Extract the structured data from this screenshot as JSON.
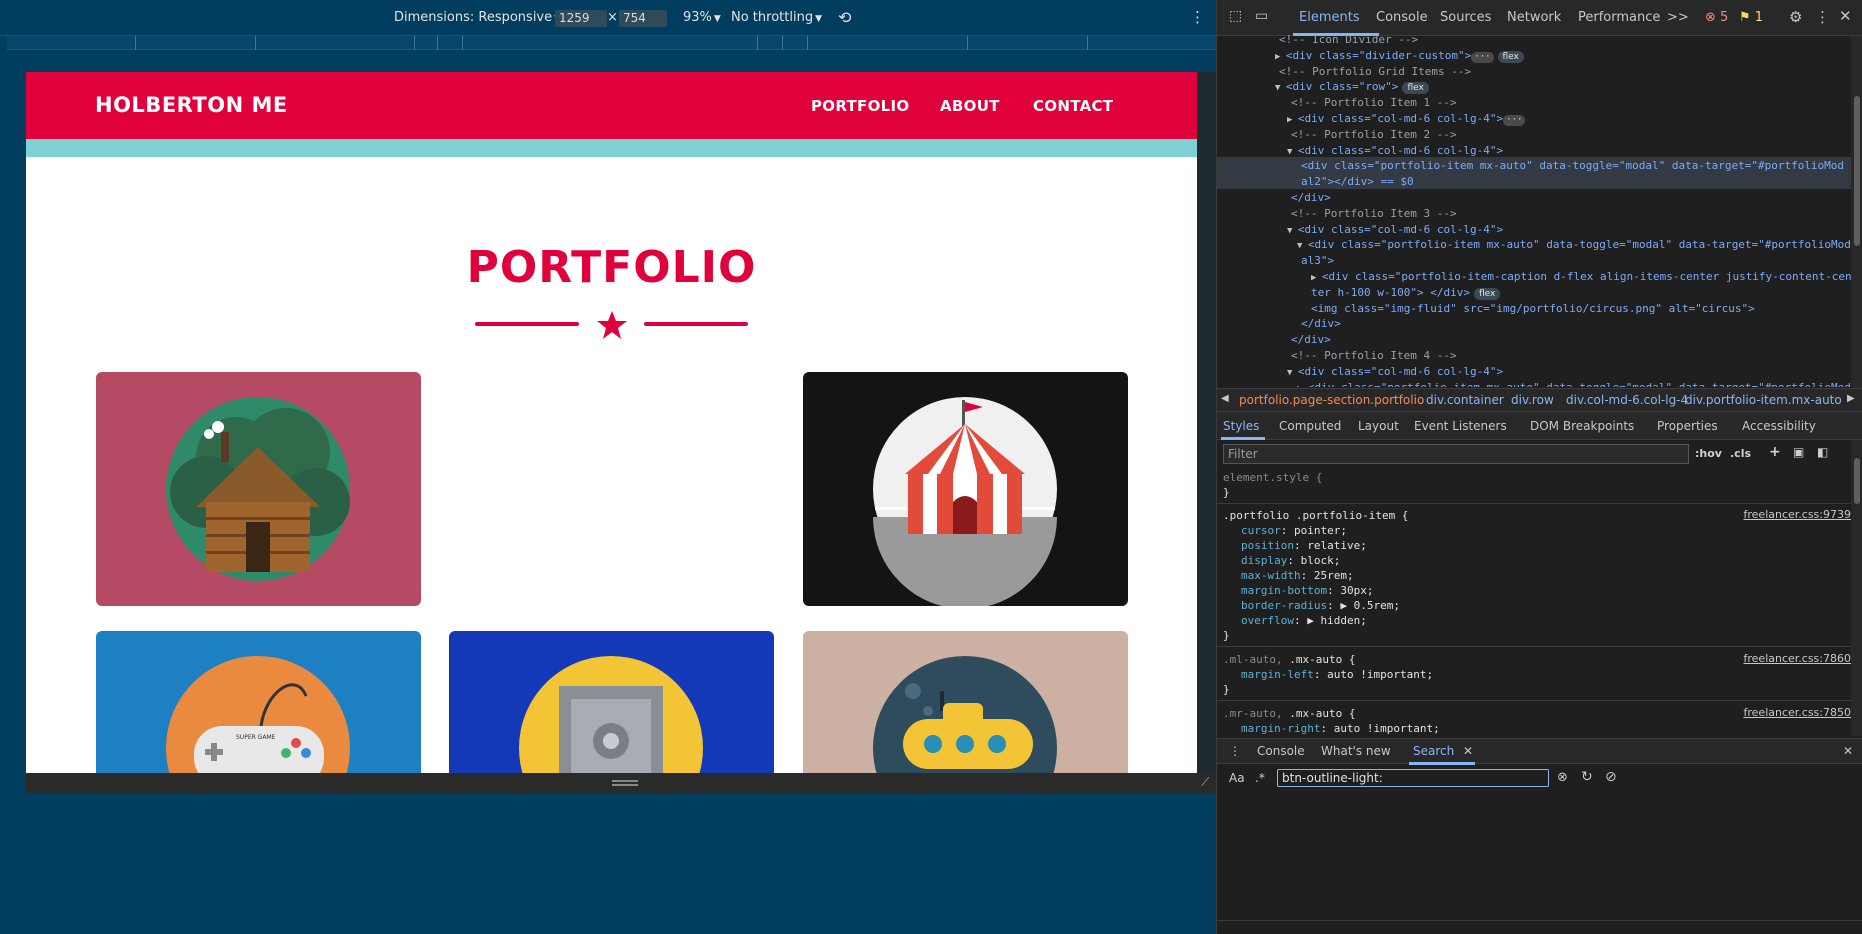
{
  "toolbar": {
    "dimensions_label": "Dimensions: Responsive",
    "width": "1259",
    "times": "×",
    "height": "754",
    "zoom": "93%",
    "throttle": "No throttling"
  },
  "site": {
    "brand": "HOLBERTON ME",
    "nav": [
      "PORTFOLIO",
      "ABOUT",
      "CONTACT"
    ],
    "title": "PORTFOLIO",
    "colors": {
      "primary": "#e0003b",
      "teal": "#7ed1d4"
    },
    "cards": [
      {
        "icon": "cabin-icon",
        "bg": "#b44a63"
      },
      {
        "icon": "circus-icon",
        "bg": "#151313"
      },
      {
        "icon": "game-controller-icon",
        "bg": "#1d80c2",
        "text": "SUPER GAME"
      },
      {
        "icon": "safe-icon",
        "bg": "#1439b8"
      },
      {
        "icon": "submarine-icon",
        "bg": "#ccb1a2"
      }
    ]
  },
  "devtools": {
    "tabs": [
      "Elements",
      "Console",
      "Sources",
      "Network",
      "Performance",
      ">>"
    ],
    "errors": "5",
    "warnings": "1",
    "code_lines": [
      {
        "t": "c",
        "text": "<!-- Icon Divider -->"
      },
      {
        "t": "tag_open_collapsed",
        "text": "<div class=\"divider-custom\">",
        "badge": "flex"
      },
      {
        "t": "c",
        "text": "<!-- Portfolio Grid Items -->"
      },
      {
        "t": "tag_open",
        "text": "<div class=\"row\">",
        "badge": "flex"
      },
      {
        "t": "c",
        "text": "<!-- Portfolio Item 1 -->"
      },
      {
        "t": "tag_open_collapsed",
        "text": "<div class=\"col-md-6 col-lg-4\">"
      },
      {
        "t": "c",
        "text": "<!-- Portfolio Item 2 -->"
      },
      {
        "t": "tag_open",
        "text": "<div class=\"col-md-6 col-lg-4\">"
      },
      {
        "t": "sel1",
        "text": "<div class=\"portfolio-item mx-auto\" data-toggle=\"modal\" data-target=\"#portfolioMod"
      },
      {
        "t": "sel2",
        "text": "al2\"></div> == $0"
      },
      {
        "t": "close",
        "text": "</div>"
      },
      {
        "t": "c",
        "text": "<!-- Portfolio Item 3 -->"
      },
      {
        "t": "tag_open",
        "text": "<div class=\"col-md-6 col-lg-4\">"
      },
      {
        "t": "tag_open",
        "text": "<div class=\"portfolio-item mx-auto\" data-toggle=\"modal\" data-target=\"#portfolioMod"
      },
      {
        "t": "cont",
        "text": "al3\">"
      },
      {
        "t": "tag_open_collapsed",
        "text": "<div class=\"portfolio-item-caption d-flex align-items-center justify-content-cen"
      },
      {
        "t": "cont",
        "text": "ter h-100 w-100\"> </div>",
        "badge": "flex"
      },
      {
        "t": "img",
        "text": "<img class=\"img-fluid\" src=\"img/portfolio/circus.png\" alt=\"circus\">"
      },
      {
        "t": "close",
        "text": "</div>"
      },
      {
        "t": "close",
        "text": "</div>"
      },
      {
        "t": "c",
        "text": "<!-- Portfolio Item 4 -->"
      },
      {
        "t": "tag_open",
        "text": "<div class=\"col-md-6 col-lg-4\">"
      },
      {
        "t": "cont",
        "text": "<div class=\"portfolio-item mx-auto\" data-toggle=\"modal\" data-target=\"#portfolioMod"
      }
    ],
    "breadcrumbs": [
      "portfolio.page-section.portfolio",
      "div.container",
      "div.row",
      "div.col-md-6.col-lg-4",
      "div.portfolio-item.mx-auto"
    ],
    "style_tabs": [
      "Styles",
      "Computed",
      "Layout",
      "Event Listeners",
      "DOM Breakpoints",
      "Properties",
      "Accessibility"
    ],
    "filter_placeholder": "Filter",
    "hov": ":hov",
    "cls": ".cls",
    "rules": {
      "element_style": "element.style {",
      "close": "}",
      "r1_selector": ".portfolio .portfolio-item {",
      "r1_source": "freelancer.css:9739",
      "r1_props": [
        [
          "cursor",
          "pointer;"
        ],
        [
          "position",
          "relative;"
        ],
        [
          "display",
          "block;"
        ],
        [
          "max-width",
          "25rem;"
        ],
        [
          "margin-bottom",
          "30px;"
        ],
        [
          "border-radius",
          "▶ 0.5rem;"
        ],
        [
          "overflow",
          "▶ hidden;"
        ]
      ],
      "r2_selector_dim": ".ml-auto, ",
      "r2_selector": ".mx-auto {",
      "r2_source": "freelancer.css:7860",
      "r2_prop": [
        "margin-left",
        "auto !important;"
      ],
      "r3_selector_dim": ".mr-auto, ",
      "r3_selector": ".mx-auto {",
      "r3_source": "freelancer.css:7850",
      "r3_prop": [
        "margin-right",
        "auto !important;"
      ]
    },
    "drawer_tabs": [
      "Console",
      "What's new",
      "Search"
    ],
    "search_aa": "Aa",
    "search_regex": ".*",
    "search_value": "btn-outline-light:"
  }
}
